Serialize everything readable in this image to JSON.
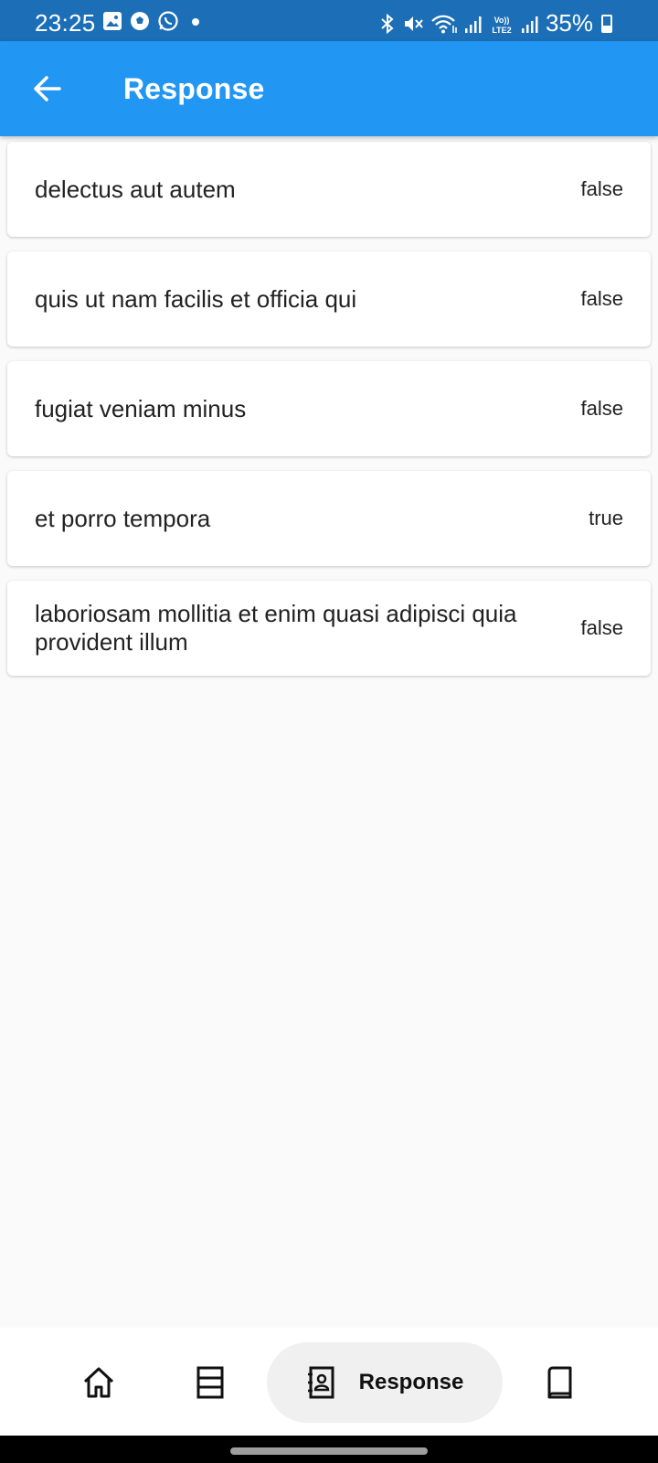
{
  "status_bar": {
    "time": "23:25",
    "battery": "35%",
    "left_icons": [
      "gallery-icon",
      "soccer-ball-icon",
      "whatsapp-icon",
      "dot-icon"
    ],
    "right_icons": [
      "bluetooth-icon",
      "mute-icon",
      "wifi-icon",
      "signal-icon",
      "volte-icon",
      "signal-icon",
      "battery-icon"
    ]
  },
  "app_bar": {
    "title": "Response",
    "back_icon": "arrow-back-icon"
  },
  "items": [
    {
      "title": "delectus aut autem",
      "status": "false"
    },
    {
      "title": "quis ut nam facilis et officia qui",
      "status": "false"
    },
    {
      "title": "fugiat veniam minus",
      "status": "false"
    },
    {
      "title": "et porro tempora",
      "status": "true"
    },
    {
      "title": "laboriosam mollitia et enim quasi adipisci quia provident illum",
      "status": "false"
    }
  ],
  "bottom_nav": {
    "items": [
      {
        "icon": "home-icon",
        "label": ""
      },
      {
        "icon": "list-icon",
        "label": ""
      },
      {
        "icon": "contacts-icon",
        "label": "Response",
        "selected": true
      },
      {
        "icon": "book-icon",
        "label": ""
      }
    ]
  }
}
